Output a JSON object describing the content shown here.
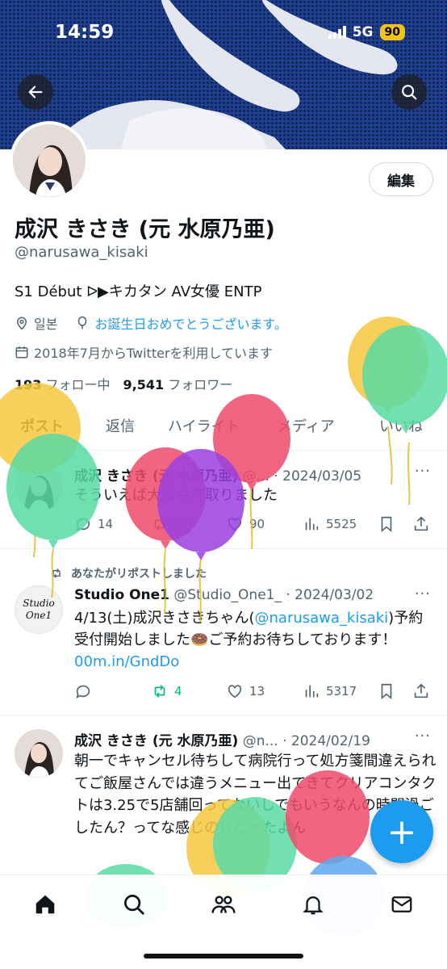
{
  "status_bar": {
    "time": "14:59",
    "network": "5G",
    "battery": "90"
  },
  "profile": {
    "edit_label": "編集",
    "display_name": "成沢 きさき (元 水原乃亜)",
    "handle": "@narusawa_kisaki",
    "bio": "S1 Début ᐅ▶キカタン AV女優 ENTP",
    "location": "일본",
    "birthday": "お誕生日おめでとうございます。",
    "joined": "2018年7月からTwitterを利用しています",
    "following_count": "193",
    "following_label": "フォロー中",
    "followers_count": "9,541",
    "followers_label": "フォロワー"
  },
  "tabs": [
    {
      "label": "ポスト"
    },
    {
      "label": "返信"
    },
    {
      "label": "ハイライト"
    },
    {
      "label": "メディア"
    },
    {
      "label": "いいね"
    }
  ],
  "posts": [
    {
      "name": "成沢 きさき (元 水原乃亜)",
      "handle": "@...",
      "date": "· 2024/03/05",
      "text": "そういえば大型免許取りました",
      "replies": "14",
      "reposts": "",
      "likes": "90",
      "views": "5525"
    },
    {
      "repost_label": "あなたがリポストしました",
      "avatar_text": "Studio One1",
      "name": "Studio One1",
      "handle": "@Studio_One1_",
      "date": "· 2024/03/02",
      "text_1": "4/13(土)成沢きさきちゃん(",
      "mention": "@narusawa_kisaki",
      "text_2": ")予約受付開始しました🍩ご予約お待ちしております！",
      "link": "00m.in/GndDo",
      "replies": "",
      "reposts": "4",
      "likes": "13",
      "views": "5317"
    },
    {
      "name": "成沢 きさき (元 水原乃亜)",
      "handle": "@n...",
      "date": "· 2024/02/19",
      "text": "朝一でキャンセル待ちして病院行って処方箋間違えられてご飯屋さんでは違うメニュー出てきてクリアコンタクトは3.25で5店舗回ってないしでもいうなんの時間過ごしたん？ってな感じの日だったよん"
    }
  ],
  "fab_label": "+",
  "nav": [
    "home-icon",
    "search-icon",
    "communities-icon",
    "notifications-icon",
    "messages-icon"
  ],
  "colors": {
    "accent": "#1d9bf0",
    "repost_green": "#00ba7c",
    "banner": "#1f3f8f"
  }
}
